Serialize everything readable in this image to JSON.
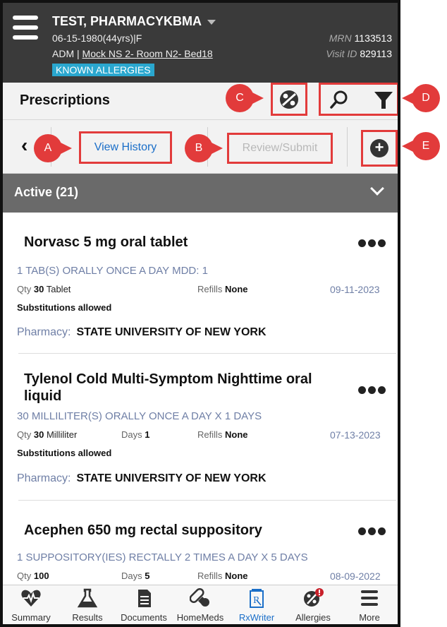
{
  "patient": {
    "name": "TEST, PHARMACYKBMA",
    "dob_line": "06-15-1980(44yrs)|F",
    "location_prefix": "ADM | ",
    "location_room": "Mock NS 2- Room N2- Bed18",
    "allergy_badge": "KNOWN ALLERGIES",
    "mrn_label": "MRN",
    "mrn_value": "1133513",
    "visit_label": "Visit ID",
    "visit_value": "829113"
  },
  "toolbar": {
    "title": "Prescriptions",
    "view_history": "View History",
    "review_submit": "Review/Submit"
  },
  "callouts": {
    "a": "A",
    "b": "B",
    "c": "C",
    "d": "D",
    "e": "E"
  },
  "section": {
    "title": "Active (21)"
  },
  "prescriptions": [
    {
      "name": "Norvasc 5 mg oral tablet",
      "sig": "1 TAB(S) ORALLY ONCE A DAY MDD: 1",
      "qty_label": "Qty",
      "qty_value": "30",
      "qty_unit": "Tablet",
      "days_label": "",
      "days_value": "",
      "refills_label": "Refills",
      "refills_value": "None",
      "date": "09-11-2023",
      "subs": "Substitutions allowed",
      "pharmacy_label": "Pharmacy:",
      "pharmacy_value": "STATE UNIVERSITY OF NEW YORK"
    },
    {
      "name": "Tylenol Cold Multi-Symptom Nighttime oral liquid",
      "sig": "30 MILLILITER(S) ORALLY ONCE A DAY X 1 DAYS",
      "qty_label": "Qty",
      "qty_value": "30",
      "qty_unit": "Milliliter",
      "days_label": "Days",
      "days_value": "1",
      "refills_label": "Refills",
      "refills_value": "None",
      "date": "07-13-2023",
      "subs": "Substitutions allowed",
      "pharmacy_label": "Pharmacy:",
      "pharmacy_value": "STATE UNIVERSITY OF NEW YORK"
    },
    {
      "name": "Acephen 650 mg rectal suppository",
      "sig": "1 SUPPOSITORY(IES) RECTALLY 2 TIMES A DAY X 5 DAYS",
      "qty_label": "Qty",
      "qty_value": "100",
      "qty_unit": "",
      "days_label": "Days",
      "days_value": "5",
      "refills_label": "Refills",
      "refills_value": "None",
      "date": "08-09-2022"
    }
  ],
  "tabs": [
    {
      "label": "Summary",
      "icon": "heart-pulse-icon"
    },
    {
      "label": "Results",
      "icon": "flask-icon"
    },
    {
      "label": "Documents",
      "icon": "document-icon"
    },
    {
      "label": "HomeMeds",
      "icon": "pills-icon"
    },
    {
      "label": "RxWriter",
      "icon": "rx-icon",
      "active": true
    },
    {
      "label": "Allergies",
      "icon": "allergy-icon"
    },
    {
      "label": "More",
      "icon": "menu-icon"
    }
  ],
  "colors": {
    "header_bg": "#3a3a3a",
    "allergy_badge": "#2aa7cf",
    "callout_red": "#e23b3b",
    "link_blue": "#1a6ec8",
    "section_bg": "#6a6a6a",
    "sig_text": "#6f7fa6"
  }
}
